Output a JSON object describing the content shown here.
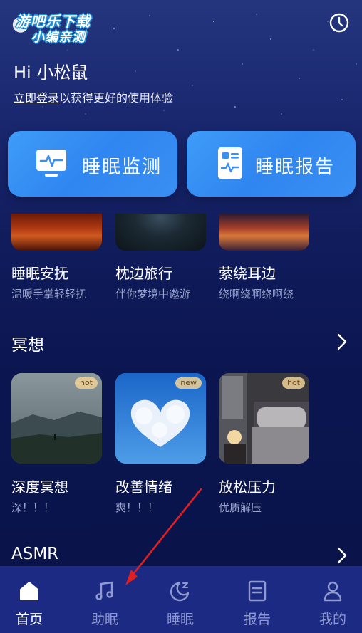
{
  "watermark": {
    "line1": "游吧乐下载",
    "line2": "小编亲测"
  },
  "header": {
    "greeting": "Hi 小松鼠",
    "login_link": "立即登录",
    "login_rest": "以获得更好的使用体验"
  },
  "cards": [
    {
      "label": "睡眠监测",
      "icon": "monitor-pulse-icon"
    },
    {
      "label": "睡眠报告",
      "icon": "report-pulse-icon"
    }
  ],
  "sleep_items": [
    {
      "title": "睡眠安抚",
      "subtitle": "温暖手掌轻轻抚"
    },
    {
      "title": "枕边旅行",
      "subtitle": "伴你梦境中遨游"
    },
    {
      "title": "萦绕耳边",
      "subtitle": "绕啊绕啊绕啊绕"
    }
  ],
  "meditation": {
    "title": "冥想",
    "items": [
      {
        "title": "深度冥想",
        "subtitle": "深！！！",
        "badge": "hot"
      },
      {
        "title": "改善情绪",
        "subtitle": "爽！！！",
        "badge": "new"
      },
      {
        "title": "放松压力",
        "subtitle": "优质解压",
        "badge": "hot"
      }
    ]
  },
  "asmr": {
    "title": "ASMR"
  },
  "tabs": [
    {
      "label": "首页",
      "icon": "home-icon",
      "active": true
    },
    {
      "label": "助眠",
      "icon": "music-note-icon",
      "active": false
    },
    {
      "label": "睡眠",
      "icon": "moon-zz-icon",
      "active": false
    },
    {
      "label": "报告",
      "icon": "document-icon",
      "active": false
    },
    {
      "label": "我的",
      "icon": "person-icon",
      "active": false
    }
  ],
  "colors": {
    "accent": "#3a8ff2",
    "tabbar": "#1c2a84",
    "annotation_arrow": "#e02020"
  }
}
